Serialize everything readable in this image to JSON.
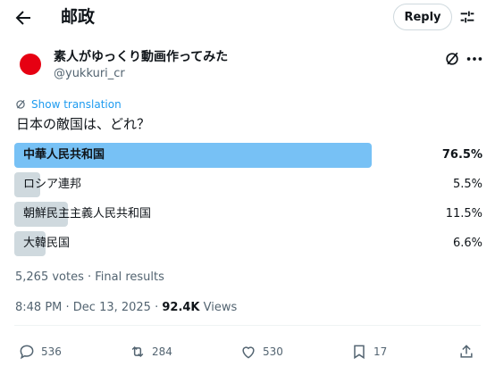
{
  "header": {
    "title": "邮政",
    "reply_label": "Reply"
  },
  "author": {
    "name": "素人がゆっくり動画作ってみた",
    "handle": "@yukkuri_cr",
    "avatar_color": "#e60012"
  },
  "translate": {
    "label": "Show translation"
  },
  "tweet": {
    "text": "日本の敵国は、どれ？"
  },
  "poll": {
    "options": [
      {
        "label": "中華人民共和国",
        "percent_text": "76.5%",
        "percent": 76.5,
        "winner": true
      },
      {
        "label": "ロシア連邦",
        "percent_text": "5.5%",
        "percent": 5.5,
        "winner": false
      },
      {
        "label": "朝鮮民主主義人民共和国",
        "percent_text": "11.5%",
        "percent": 11.5,
        "winner": false
      },
      {
        "label": "大韓民国",
        "percent_text": "6.6%",
        "percent": 6.6,
        "winner": false
      }
    ],
    "meta": "5,265 votes · Final results",
    "winner_color": "#77c1f5",
    "bar_color": "#cfd9de"
  },
  "timestamp": {
    "time": "8:48 PM · Dec 13, 2025 · ",
    "views_count": "92.4K",
    "views_label": " Views"
  },
  "actions": {
    "replies": "536",
    "reposts": "284",
    "likes": "530",
    "bookmarks": "17"
  },
  "accent_color": "#1d9bf0"
}
